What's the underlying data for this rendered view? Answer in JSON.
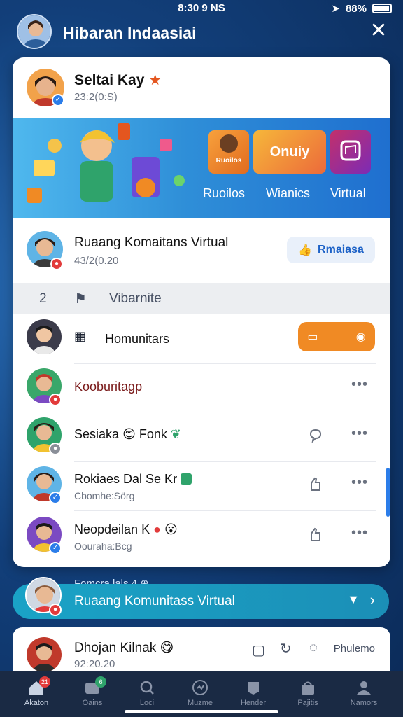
{
  "status_bar": {
    "time": "8:30 9 NS",
    "battery": "88%",
    "battery_level": 0.88
  },
  "header": {
    "title": "Hibaran Indaasiai",
    "close_icon": "close-icon"
  },
  "post": {
    "author": "Seltai Kay",
    "timestamp": "23:2(0:S)"
  },
  "banner": {
    "tiles": [
      "Ruoilos",
      "Onuiy"
    ],
    "labels": [
      "Ruoilos",
      "Wianics",
      "Virtual"
    ]
  },
  "community": {
    "name": "Ruaang Komaitans Virtual",
    "timestamp": "43/2(0.20",
    "join_label": "Rmaiasa"
  },
  "section": {
    "number": "2",
    "title": "Vibarnite"
  },
  "list": [
    {
      "name": "Homunitars",
      "sub": ""
    },
    {
      "name": "Kooburitagp",
      "sub": ""
    },
    {
      "name": "Sesiaka",
      "name_suffix": "Fonk",
      "sub": ""
    },
    {
      "name": "Rokiaes Dal Se Kr",
      "sub": "Cbomhe:Sörg"
    },
    {
      "name": "Neopdeilan K",
      "sub": "Oouraha:Bcg"
    }
  ],
  "more_label": "•••",
  "floating": {
    "caption": "Fomcra lals 4",
    "title": "Ruaang Komunitass Virtual"
  },
  "bottom_post": {
    "name": "Dhojan Kilnak",
    "timestamp": "92:20.20",
    "action_label": "Phulemo"
  },
  "tabs": [
    {
      "label": "Akaton",
      "icon": "home-icon",
      "badge": "21"
    },
    {
      "label": "Oains",
      "icon": "cards-icon",
      "badge": "6"
    },
    {
      "label": "Loci",
      "icon": "search-icon",
      "badge": ""
    },
    {
      "label": "Muzme",
      "icon": "music-icon",
      "badge": ""
    },
    {
      "label": "Hender",
      "icon": "heart-icon",
      "badge": ""
    },
    {
      "label": "Pajitis",
      "icon": "shop-icon",
      "badge": ""
    },
    {
      "label": "Namors",
      "icon": "profile-icon",
      "badge": ""
    }
  ],
  "colors": {
    "accent": "#1d62c7",
    "orange": "#f08a24",
    "teal_bar": "#1aa3c6",
    "background": "#123f7a"
  }
}
